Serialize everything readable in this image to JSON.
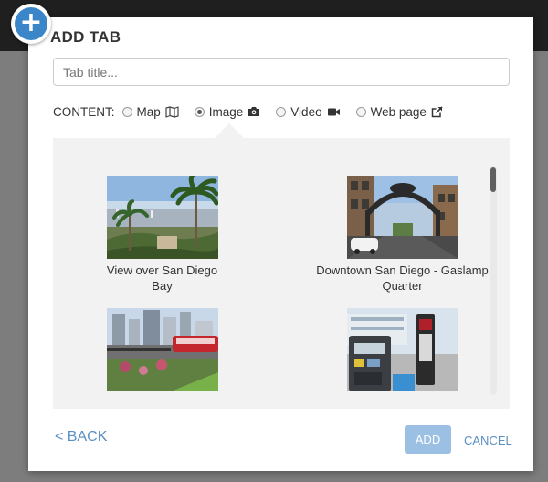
{
  "dialog": {
    "title": "ADD TAB",
    "tab_title_placeholder": "Tab title...",
    "content_label": "CONTENT:",
    "options": [
      {
        "label": "Map",
        "icon": "map-icon",
        "checked": false
      },
      {
        "label": "Image",
        "icon": "camera-icon",
        "checked": true
      },
      {
        "label": "Video",
        "icon": "video-camera-icon",
        "checked": false
      },
      {
        "label": "Web page",
        "icon": "external-link-icon",
        "checked": false
      }
    ],
    "images": [
      {
        "caption": "View over San Diego Bay"
      },
      {
        "caption": "Downtown San Diego - Gaslamp Quarter"
      },
      {
        "caption": ""
      },
      {
        "caption": ""
      }
    ],
    "back_label": "< BACK",
    "add_label": "ADD",
    "cancel_label": "CANCEL"
  },
  "colors": {
    "accent": "#3a86c9",
    "link": "#5b8fc2",
    "add_button": "#9cc0e4",
    "topbar": "#1f1f1f"
  }
}
